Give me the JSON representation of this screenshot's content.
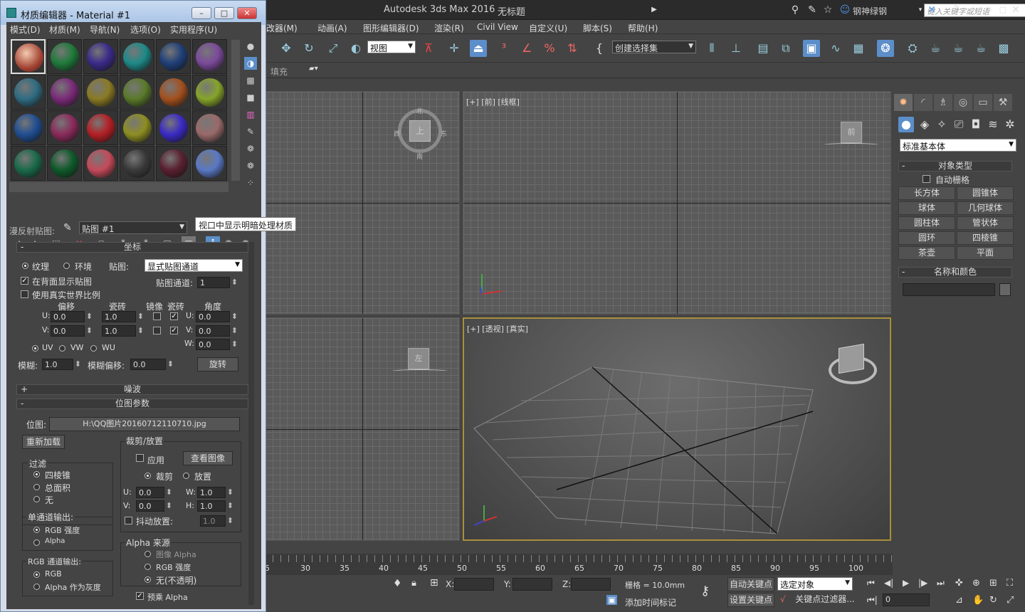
{
  "main": {
    "title": "Autodesk 3ds Max 2016",
    "doc": "无标题",
    "search_placeholder": "键入关键字或短语",
    "user": "钢神绿钢",
    "menus": [
      "改器(M)",
      "动画(A)",
      "图形编辑器(D)",
      "渲染(R)",
      "Civil View",
      "自定义(U)",
      "脚本(S)",
      "帮助(H)"
    ],
    "view_dropdown": "视图",
    "selection_set": "创建选择集",
    "ribbon_label": "填充",
    "viewports": {
      "front_label": "[+] [前] [线框]",
      "persp_label": "[+] [透视] [真实]",
      "top_cube": "上",
      "left_cube": "左",
      "front_cube": "前",
      "compass": {
        "n": "北",
        "s": "南",
        "w": "西",
        "e": "东"
      }
    },
    "command_panel": {
      "dropdown": "标准基本体",
      "object_type_title": "对象类型",
      "auto_grid": "自动栅格",
      "buttons": [
        "长方体",
        "圆锥体",
        "球体",
        "几何球体",
        "圆柱体",
        "管状体",
        "圆环",
        "四棱锥",
        "茶壶",
        "平面"
      ],
      "name_color_title": "名称和颜色"
    },
    "timeline": {
      "ticks": [
        "5",
        "30",
        "35",
        "40",
        "45",
        "50",
        "55",
        "60",
        "65",
        "70",
        "75",
        "80",
        "85",
        "90",
        "95",
        "100"
      ]
    },
    "status": {
      "x_label": "X:",
      "y_label": "Y:",
      "z_label": "Z:",
      "grid": "栅格 = 10.0mm",
      "auto_key": "自动关键点",
      "selected": "选定对象",
      "set_key": "设置关键点",
      "key_filter": "关键点过滤器...",
      "add_time_tag": "添加时间标记",
      "frame": "0"
    }
  },
  "medit": {
    "title": "材质编辑器 - Material #1",
    "menus": [
      "模式(D)",
      "材质(M)",
      "导航(N)",
      "选项(O)",
      "实用程序(U)"
    ],
    "slot_colors": [
      "#1f7a3a",
      "#3b2a8a",
      "#1d8a88",
      "#1f3f78",
      "#7a4a9a",
      "#2f6c82",
      "#7a2a78",
      "#8a7a24",
      "#5a7a2a",
      "#a4501e",
      "#86a42a",
      "#204e92",
      "#8a2a5a",
      "#b41f24",
      "#8e8e22",
      "#3a2ac4",
      "#9a6a6a",
      "#1a6a4a",
      "#0e5a2a",
      "#c44a5a",
      "#3a3a3a",
      "#5a2030",
      "#5a78c4"
    ],
    "diffuse_label": "漫反射贴图:",
    "map_name": "贴图 #1",
    "tooltip": "视口中显示明暗处理材质",
    "coords": {
      "title": "坐标",
      "texture": "纹理",
      "env": "环境",
      "map": "贴图:",
      "map_dd": "显式贴图通道",
      "show_back": "在背面显示贴图",
      "channel_label": "贴图通道:",
      "channel": "1",
      "real_world": "使用真实世界比例",
      "offset": "偏移",
      "tiling": "瓷砖",
      "mirror": "镜像",
      "tile": "瓷砖",
      "angle": "角度",
      "u": "U:",
      "v": "V:",
      "w": "W:",
      "u_off": "0.0",
      "v_off": "0.0",
      "u_tile": "1.0",
      "v_tile": "1.0",
      "ang_u": "0.0",
      "ang_v": "0.0",
      "ang_w": "0.0",
      "uv": "UV",
      "vw": "VW",
      "wu": "WU",
      "blur": "模糊:",
      "blur_v": "1.0",
      "blur_off": "模糊偏移:",
      "blur_off_v": "0.0",
      "rotate": "旋转"
    },
    "noise_title": "噪波",
    "bitmap": {
      "title": "位图参数",
      "path_label": "位图:",
      "path": "H:\\QQ图片20160712110710.jpg",
      "reload": "重新加载",
      "crop_title": "裁剪/放置",
      "apply": "应用",
      "view_image": "查看图像",
      "crop": "裁剪",
      "place": "放置",
      "u": "U:",
      "v": "V:",
      "w": "W:",
      "h": "H:",
      "cu": "0.0",
      "cv": "0.0",
      "cw": "1.0",
      "ch": "1.0",
      "jitter": "抖动放置:",
      "jitter_v": "1.0",
      "filter_title": "过滤",
      "pyramid": "四棱锥",
      "sat": "总面积",
      "none": "无",
      "mono_title": "单通道输出:",
      "rgb_int": "RGB 强度",
      "alpha": "Alpha",
      "rgb_out_title": "RGB 通道输出:",
      "rgb": "RGB",
      "alpha_gray": "Alpha 作为灰度",
      "alpha_src_title": "Alpha 来源",
      "img_alpha": "图像 Alpha",
      "rgb_int2": "RGB 强度",
      "opaque": "无(不透明)",
      "premult": "预乘 Alpha"
    }
  }
}
